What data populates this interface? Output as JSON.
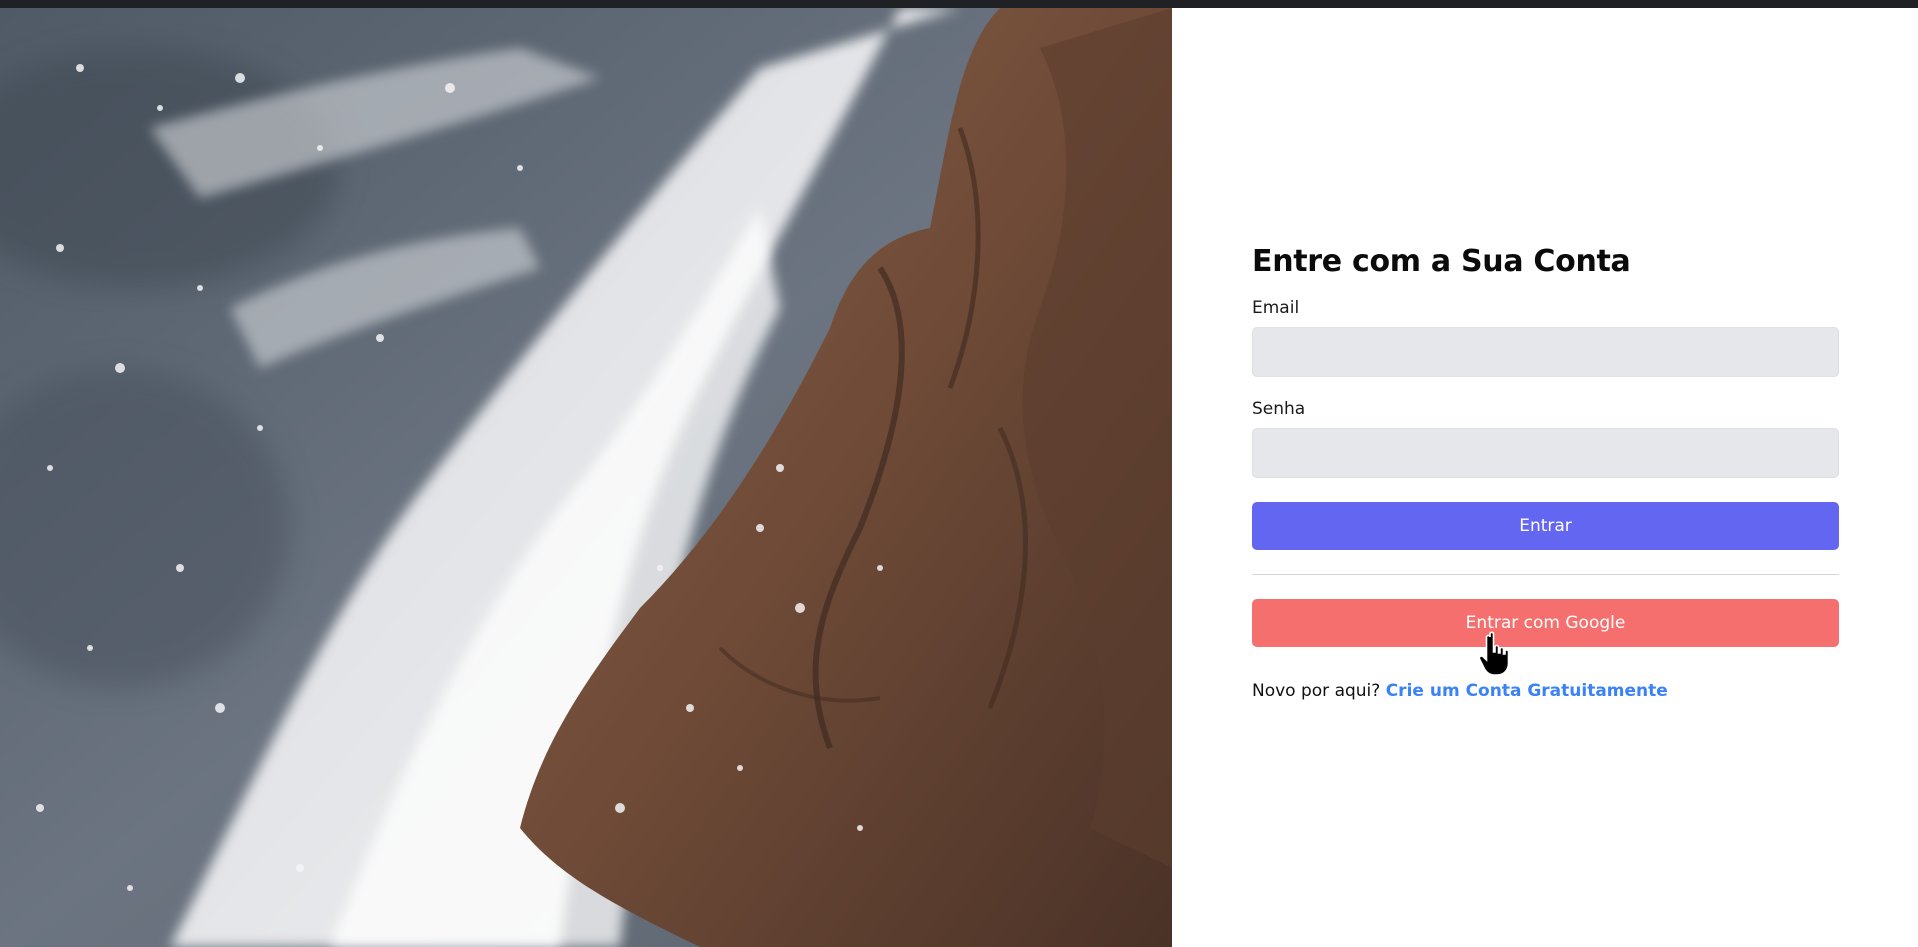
{
  "login": {
    "title": "Entre com a Sua Conta",
    "email_label": "Email",
    "email_value": "",
    "password_label": "Senha",
    "password_value": "",
    "submit_label": "Entrar",
    "google_label": "Entrar com Google",
    "signup_prompt": "Novo por aqui?",
    "signup_link": "Crie um Conta Gratuitamente"
  },
  "colors": {
    "primary": "#6366f1",
    "google": "#f56f6f",
    "link": "#3b82f6",
    "input_bg": "#e6e7ea"
  },
  "icons": {
    "cursor": "hand-pointer-icon"
  }
}
